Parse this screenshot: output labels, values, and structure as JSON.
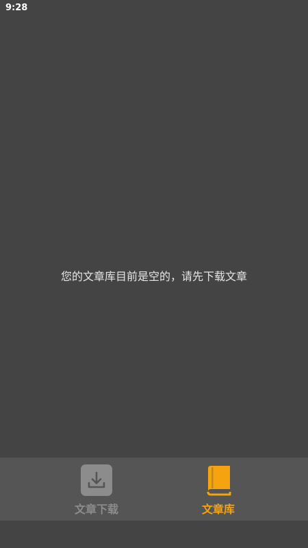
{
  "status_bar": {
    "time": "9:28"
  },
  "library": {
    "empty_message": "您的文章库目前是空的，请先下载文章"
  },
  "bottom_nav": {
    "tabs": [
      {
        "label": "文章下载",
        "icon": "download-icon",
        "active": false
      },
      {
        "label": "文章库",
        "icon": "book-icon",
        "active": true
      }
    ]
  },
  "colors": {
    "background": "#444444",
    "nav_background": "#555555",
    "accent": "#f5a30f",
    "inactive": "#8c8c8c"
  }
}
